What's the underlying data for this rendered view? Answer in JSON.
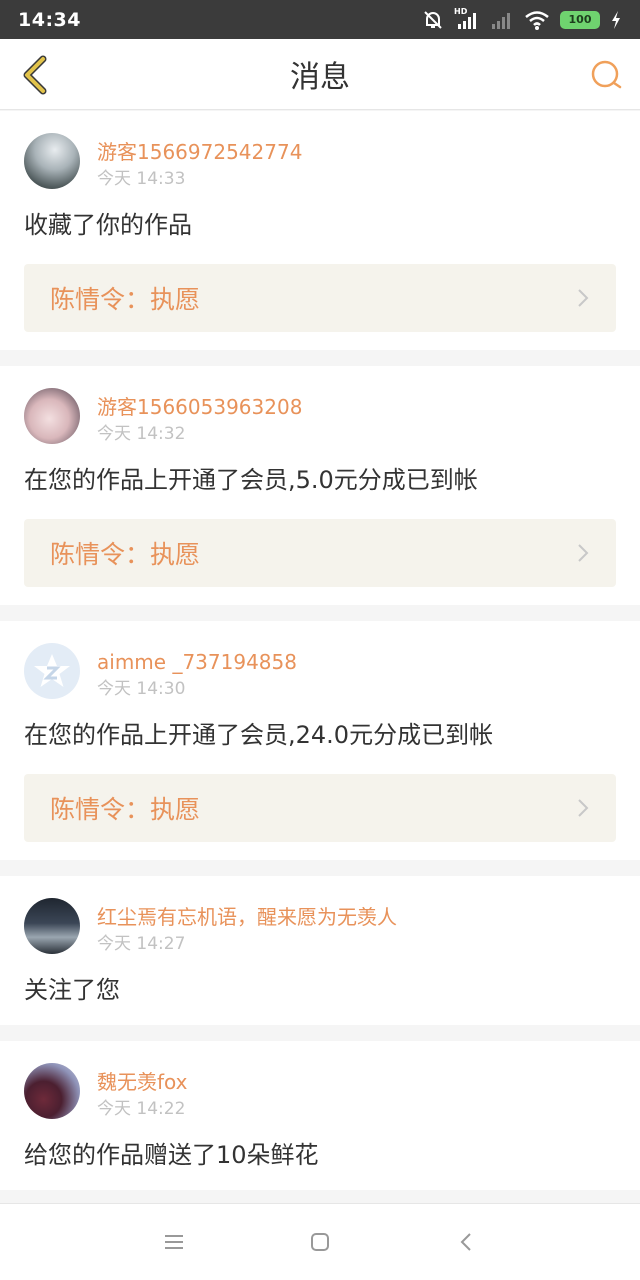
{
  "status": {
    "time": "14:34",
    "battery": "100",
    "hd": "HD"
  },
  "header": {
    "title": "消息"
  },
  "messages": [
    {
      "user": "游客1566972542774",
      "time": "今天 14:33",
      "text": "收藏了你的作品",
      "work": "陈情令：执愿",
      "avatar": "sky-photo-avatar"
    },
    {
      "user": "游客1566053963208",
      "time": "今天 14:32",
      "text": "在您的作品上开通了会员,5.0元分成已到帐",
      "work": "陈情令：执愿",
      "avatar": "face-photo-avatar"
    },
    {
      "user": "aimme _737194858",
      "time": "今天 14:30",
      "text": "在您的作品上开通了会员,24.0元分成已到帐",
      "work": "陈情令：执愿",
      "avatar": "default-logo-avatar"
    },
    {
      "user": "红尘焉有忘机语，醒来愿为无羡人",
      "time": "今天 14:27",
      "text": "关注了您",
      "avatar": "figure-photo-avatar"
    },
    {
      "user": "魏无羡fox",
      "time": "今天 14:22",
      "text": "给您的作品赠送了10朵鲜花",
      "avatar": "flower-photo-avatar"
    }
  ],
  "colors": {
    "accent": "#e8925a",
    "back_arrow": "#e2c34a",
    "work_bg": "#f5f3ec"
  }
}
